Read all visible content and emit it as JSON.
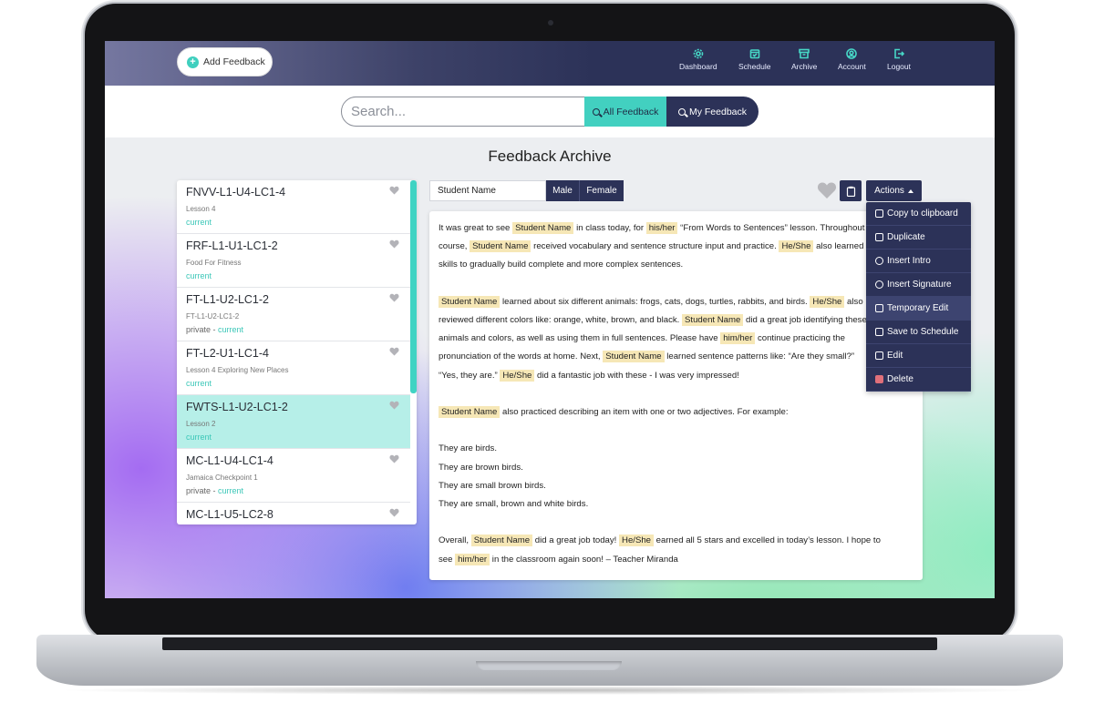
{
  "nav": {
    "add_feedback": "Add Feedback",
    "items": [
      {
        "label": "Dashboard",
        "icon": "gear-icon"
      },
      {
        "label": "Schedule",
        "icon": "calendar-icon"
      },
      {
        "label": "Archive",
        "icon": "archive-icon"
      },
      {
        "label": "Account",
        "icon": "user-icon"
      },
      {
        "label": "Logout",
        "icon": "logout-icon"
      }
    ]
  },
  "search": {
    "placeholder": "Search...",
    "all_feedback": "All Feedback",
    "my_feedback": "My Feedback"
  },
  "page_title": "Feedback Archive",
  "list": [
    {
      "title": "FNVV-L1-U4-LC1-4",
      "subtitle": "Lesson 4",
      "private": "",
      "status": "current",
      "active": false
    },
    {
      "title": "FRF-L1-U1-LC1-2",
      "subtitle": "Food For Fitness",
      "private": "",
      "status": "current",
      "active": false
    },
    {
      "title": "FT-L1-U2-LC1-2",
      "subtitle": "FT-L1-U2-LC1-2",
      "private": "private - ",
      "status": "current",
      "active": false
    },
    {
      "title": "FT-L2-U1-LC1-4",
      "subtitle": "Lesson 4 Exploring New Places",
      "private": "",
      "status": "current",
      "active": false
    },
    {
      "title": "FWTS-L1-U2-LC1-2",
      "subtitle": "Lesson 2",
      "private": "",
      "status": "current",
      "active": true
    },
    {
      "title": "MC-L1-U4-LC1-4",
      "subtitle": "Jamaica Checkpoint 1",
      "private": "private - ",
      "status": "current",
      "active": false
    },
    {
      "title": "MC-L1-U5-LC2-8",
      "subtitle": "",
      "private": "",
      "status": "",
      "active": false
    }
  ],
  "detail": {
    "student_name_field": "Student Name",
    "male": "Male",
    "female": "Female",
    "actions": "Actions"
  },
  "dropdown": [
    {
      "label": "Copy to clipboard",
      "icon": "clipboard-icon"
    },
    {
      "label": "Duplicate",
      "icon": "duplicate-icon"
    },
    {
      "label": "Insert Intro",
      "icon": "plus-circle-icon"
    },
    {
      "label": "Insert Signature",
      "icon": "plus-circle-icon"
    },
    {
      "label": "Temporary Edit",
      "icon": "edit-icon"
    },
    {
      "label": "Save to Schedule",
      "icon": "calendar-icon"
    },
    {
      "label": "Edit",
      "icon": "edit-icon"
    },
    {
      "label": "Delete",
      "icon": "trash-icon"
    }
  ],
  "feedback_lines": [
    [
      {
        "t": "It was great to see "
      },
      {
        "t": "Student Name",
        "h": true
      },
      {
        "t": " in class today, for "
      },
      {
        "t": "his/her",
        "h": true
      },
      {
        "t": " “From Words to Sentences” lesson. Throughout the"
      }
    ],
    [
      {
        "t": "course, "
      },
      {
        "t": "Student Name",
        "h": true
      },
      {
        "t": " received vocabulary and sentence structure input and practice. "
      },
      {
        "t": "He/She",
        "h": true
      },
      {
        "t": " also learned"
      }
    ],
    [
      {
        "t": "skills to gradually build complete and more complex sentences."
      }
    ],
    [
      {
        "t": ""
      }
    ],
    [
      {
        "t": "Student Name",
        "h": true
      },
      {
        "t": " learned about six different animals: frogs, cats, dogs, turtles, rabbits, and birds. "
      },
      {
        "t": "He/She",
        "h": true
      },
      {
        "t": " also"
      }
    ],
    [
      {
        "t": "reviewed different colors like: orange, white, brown, and black. "
      },
      {
        "t": "Student Name",
        "h": true
      },
      {
        "t": " did a great job identifying these"
      }
    ],
    [
      {
        "t": "animals and colors, as well as using them in full sentences. Please have "
      },
      {
        "t": "him/her",
        "h": true
      },
      {
        "t": " continue practicing the"
      }
    ],
    [
      {
        "t": "pronunciation of the words at home. Next, "
      },
      {
        "t": "Student Name",
        "h": true
      },
      {
        "t": " learned sentence patterns like: “Are they small?”"
      }
    ],
    [
      {
        "t": "“Yes, they are.” "
      },
      {
        "t": "He/She",
        "h": true
      },
      {
        "t": " did a fantastic job with these - I was very impressed!"
      }
    ],
    [
      {
        "t": ""
      }
    ],
    [
      {
        "t": "Student Name",
        "h": true
      },
      {
        "t": " also practiced describing an item with one or two adjectives. For example:"
      }
    ],
    [
      {
        "t": ""
      }
    ],
    [
      {
        "t": "They are birds."
      }
    ],
    [
      {
        "t": "They are brown birds."
      }
    ],
    [
      {
        "t": "They are small brown birds."
      }
    ],
    [
      {
        "t": "They are small, brown and white birds."
      }
    ],
    [
      {
        "t": ""
      }
    ],
    [
      {
        "t": "Overall, "
      },
      {
        "t": "Student Name",
        "h": true
      },
      {
        "t": " did a great job today! "
      },
      {
        "t": "He/She",
        "h": true
      },
      {
        "t": " earned all 5 stars and excelled in today’s lesson.  I hope to"
      }
    ],
    [
      {
        "t": "see "
      },
      {
        "t": "him/her",
        "h": true
      },
      {
        "t": " in the classroom again soon! – Teacher Miranda"
      }
    ]
  ]
}
